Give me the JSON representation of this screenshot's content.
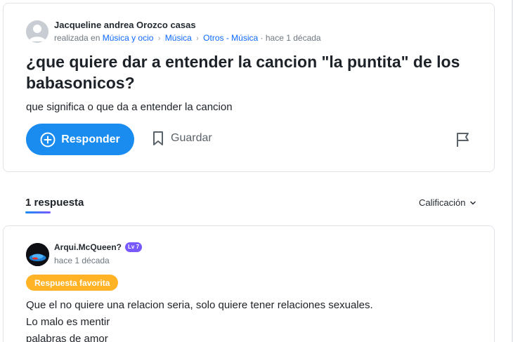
{
  "question": {
    "author": "Jacqueline andrea Orozco casas",
    "asked_prefix": "realizada en",
    "breadcrumbs": [
      "Música y ocio",
      "Música",
      "Otros - Música"
    ],
    "time": "hace 1 década",
    "title": "¿que quiere dar a entender la cancion \"la puntita\" de los babasonicos?",
    "body": "que significa o que da a entender la cancion",
    "answer_label": "Responder",
    "save_label": "Guardar"
  },
  "answers_section": {
    "count_label": "1 respuesta",
    "sort_label": "Calificación"
  },
  "answer": {
    "author": "Arqui.McQueen?",
    "level": "Lv 7",
    "time": "hace 1 década",
    "badge": "Respuesta favorita",
    "lines": [
      "Que el no quiere una relacion seria, solo quiere tener relaciones sexuales.",
      "Lo malo es mentir",
      "palabras de amor"
    ]
  },
  "colors": {
    "accent": "#1a8cf0",
    "link": "#0f69ff",
    "level": "#7759ff",
    "favorite": "#ffb325"
  }
}
